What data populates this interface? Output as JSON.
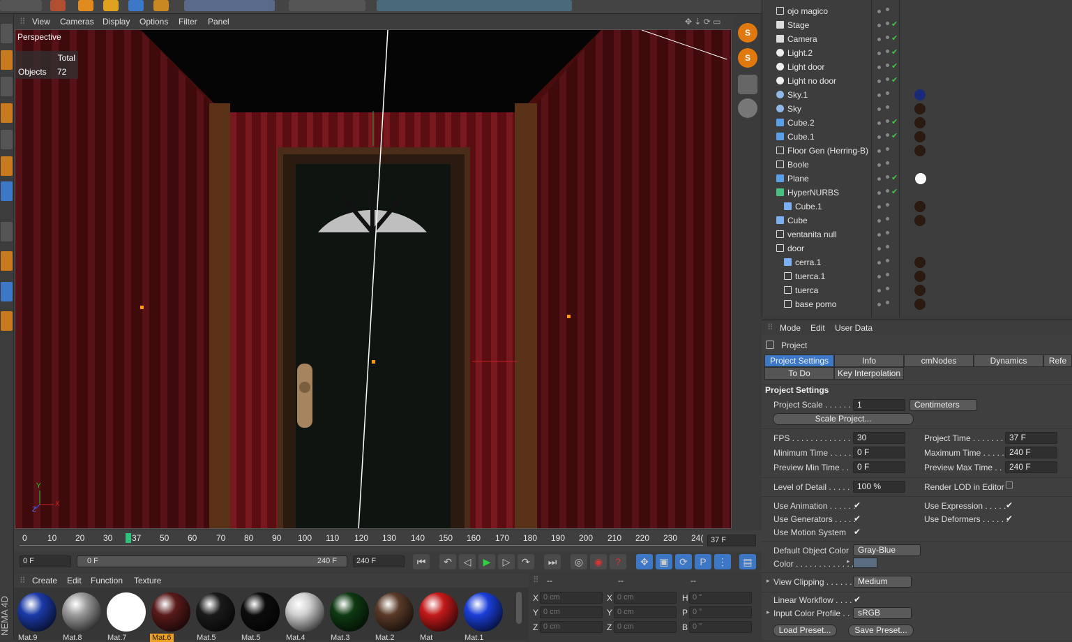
{
  "viewport": {
    "menu": [
      "View",
      "Cameras",
      "Display",
      "Options",
      "Filter",
      "Panel"
    ],
    "label": "Perspective",
    "hud_header": "Total",
    "hud_row_label": "Objects",
    "hud_row_value": "72",
    "axis_y": "Y",
    "axis_x": "X",
    "axis_z": "Z"
  },
  "timeline": {
    "ticks": [
      "0",
      "10",
      "20",
      "30",
      "37",
      "50",
      "60",
      "70",
      "80",
      "90",
      "100",
      "110",
      "120",
      "130",
      "140",
      "150",
      "160",
      "170",
      "180",
      "190",
      "200",
      "210",
      "220",
      "230",
      "24("
    ],
    "current_frame": "37 F",
    "start_field": "0 F",
    "range_start": "0 F",
    "range_end": "240 F",
    "end_field": "240 F"
  },
  "materials": {
    "menu": [
      "Create",
      "Edit",
      "Function",
      "Texture"
    ],
    "items": [
      {
        "label": "Mat.9",
        "color": "#1b3aa8"
      },
      {
        "label": "Mat.8",
        "color": "#9a9a9a"
      },
      {
        "label": "Mat.7",
        "color": "#ffffff"
      },
      {
        "label": "Mat.6",
        "color": "#5a1a1a"
      },
      {
        "label": "Mat.5",
        "color": "#1a1a1a"
      },
      {
        "label": "Mat.5",
        "color": "#0c0c0c"
      },
      {
        "label": "Mat.4",
        "color": "#cfcfcf"
      },
      {
        "label": "Mat.3",
        "color": "#0e3a12"
      },
      {
        "label": "Mat.2",
        "color": "#5a3a28"
      },
      {
        "label": "Mat",
        "color": "#c41a1a"
      },
      {
        "label": "Mat.1",
        "color": "#1a3fd8"
      }
    ],
    "logo_text": "NEMA 4D"
  },
  "coordinates": {
    "header": [
      "--",
      "--",
      "--"
    ],
    "rows": [
      {
        "a": "X",
        "av": "0 cm",
        "b": "X",
        "bv": "0 cm",
        "c": "H",
        "cv": "0 °"
      },
      {
        "a": "Y",
        "av": "0 cm",
        "b": "Y",
        "bv": "0 cm",
        "c": "P",
        "cv": "0 °"
      },
      {
        "a": "Z",
        "av": "0 cm",
        "b": "Z",
        "bv": "0 cm",
        "c": "B",
        "cv": "0 °"
      }
    ]
  },
  "objects": [
    {
      "name": "ojo magico",
      "type": "null",
      "indent": 0
    },
    {
      "name": "Stage",
      "type": "stage",
      "indent": 0
    },
    {
      "name": "Camera",
      "type": "camera",
      "indent": 0
    },
    {
      "name": "Light.2",
      "type": "light",
      "indent": 0
    },
    {
      "name": "Light door",
      "type": "light",
      "indent": 0
    },
    {
      "name": "Light no door",
      "type": "light",
      "indent": 0
    },
    {
      "name": "Sky.1",
      "type": "sky",
      "indent": 0
    },
    {
      "name": "Sky",
      "type": "sky",
      "indent": 0
    },
    {
      "name": "Cube.2",
      "type": "cube",
      "indent": 0
    },
    {
      "name": "Cube.1",
      "type": "cube",
      "indent": 0
    },
    {
      "name": "Floor Gen (Herring-B)",
      "type": "null",
      "indent": 0
    },
    {
      "name": "Boole",
      "type": "null",
      "indent": 0
    },
    {
      "name": "Plane",
      "type": "plane",
      "indent": 0
    },
    {
      "name": "HyperNURBS",
      "type": "nurbs",
      "indent": 0
    },
    {
      "name": "Cube.1",
      "type": "poly",
      "indent": 1
    },
    {
      "name": "Cube",
      "type": "poly",
      "indent": 0
    },
    {
      "name": "ventanita null",
      "type": "null",
      "indent": 0
    },
    {
      "name": "door",
      "type": "null",
      "indent": 0
    },
    {
      "name": "cerra.1",
      "type": "poly",
      "indent": 1
    },
    {
      "name": "tuerca.1",
      "type": "null",
      "indent": 1
    },
    {
      "name": "tuerca",
      "type": "null",
      "indent": 1
    },
    {
      "name": "base pomo",
      "type": "null",
      "indent": 1
    }
  ],
  "attributes": {
    "menu": [
      "Mode",
      "Edit",
      "User Data"
    ],
    "title": "Project",
    "tabs_row1": [
      "Project Settings",
      "Info",
      "cmNodes",
      "Dynamics",
      "Refe"
    ],
    "tabs_row2": [
      "To Do",
      "Key Interpolation"
    ],
    "section": "Project Settings",
    "project_scale_label": "Project Scale . . . . . . .",
    "project_scale_value": "1",
    "project_scale_unit": "Centimeters",
    "scale_button": "Scale Project...",
    "fps_label": "FPS . . . . . . . . . . . . . . . .",
    "fps_value": "30",
    "project_time_label": "Project Time . . . . . . . .",
    "project_time_value": "37 F",
    "min_time_label": "Minimum Time . . . . . . .",
    "min_time_value": "0 F",
    "max_time_label": "Maximum Time . . . . . .",
    "max_time_value": "240 F",
    "prev_min_label": "Preview Min Time . .",
    "prev_min_value": "0 F",
    "prev_max_label": "Preview Max Time . .",
    "prev_max_value": "240 F",
    "lod_label": "Level of Detail . . . . . .",
    "lod_value": "100 %",
    "render_lod_label": "Render LOD in Editor",
    "use_animation": "Use Animation . . . . . .",
    "use_expression": "Use Expression . . . . .",
    "use_generators": "Use Generators . . . . .",
    "use_deformers": "Use Deformers . . . . . .",
    "use_motion": "Use Motion System",
    "default_color_label": "Default Object Color",
    "default_color_value": "Gray-Blue",
    "color_label": "Color . . . . . . . . . . . . .",
    "view_clipping_label": "View Clipping . . . . . .",
    "view_clipping_value": "Medium",
    "linear_workflow": "Linear Workflow . . . .",
    "input_profile_label": "Input Color Profile . .",
    "input_profile_value": "sRGB",
    "load_preset": "Load Preset...",
    "save_preset": "Save Preset...",
    "check": "✔"
  }
}
